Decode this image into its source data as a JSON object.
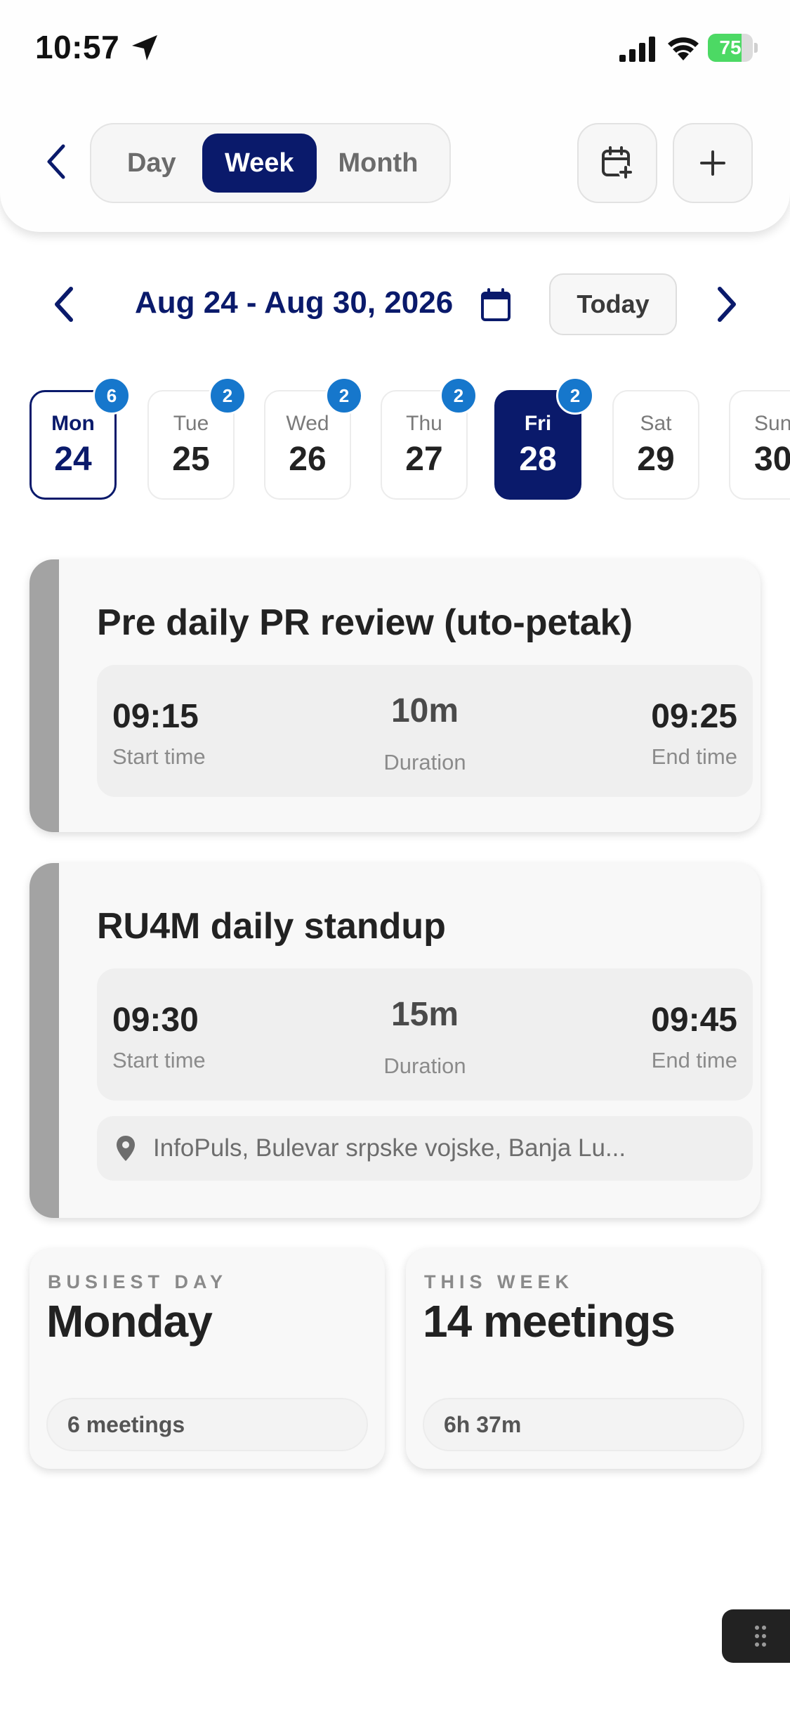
{
  "status_bar": {
    "time": "10:57",
    "battery_level": "75",
    "icons": [
      "location-arrow-icon",
      "cellular-signal-icon",
      "wifi-icon",
      "battery-charging-icon"
    ]
  },
  "header": {
    "segments": {
      "day": "Day",
      "week": "Week",
      "month": "Month",
      "active": "Week"
    },
    "icons": [
      "chevron-left-icon",
      "calendar-add-icon",
      "plus-icon"
    ]
  },
  "week_nav": {
    "range": "Aug 24 - Aug 30, 2026",
    "today_label": "Today"
  },
  "days": [
    {
      "name": "Mon",
      "num": "24",
      "badge": "6",
      "state": "today"
    },
    {
      "name": "Tue",
      "num": "25",
      "badge": "2"
    },
    {
      "name": "Wed",
      "num": "26",
      "badge": "2"
    },
    {
      "name": "Thu",
      "num": "27",
      "badge": "2"
    },
    {
      "name": "Fri",
      "num": "28",
      "badge": "2",
      "state": "selected"
    },
    {
      "name": "Sat",
      "num": "29"
    },
    {
      "name": "Sun",
      "num": "30"
    }
  ],
  "events": [
    {
      "title": "Pre daily PR review (uto-petak)",
      "start": "09:15",
      "start_label": "Start time",
      "duration": "10m",
      "duration_label": "Duration",
      "end": "09:25",
      "end_label": "End time"
    },
    {
      "title": "RU4M daily standup",
      "start": "09:30",
      "start_label": "Start time",
      "duration": "15m",
      "duration_label": "Duration",
      "end": "09:45",
      "end_label": "End time",
      "location": "InfoPuls, Bulevar srpske vojske, Banja Lu..."
    }
  ],
  "stats": {
    "busiest": {
      "eyebrow": "BUSIEST DAY",
      "value": "Monday",
      "pill": "6 meetings"
    },
    "week": {
      "eyebrow": "THIS WEEK",
      "value": "14 meetings",
      "pill": "6h 37m"
    }
  },
  "colors": {
    "navy": "#0a1a6b",
    "badge_blue": "#1677cc",
    "battery_green": "#4cd964",
    "event_bar": "#a3a3a3"
  }
}
